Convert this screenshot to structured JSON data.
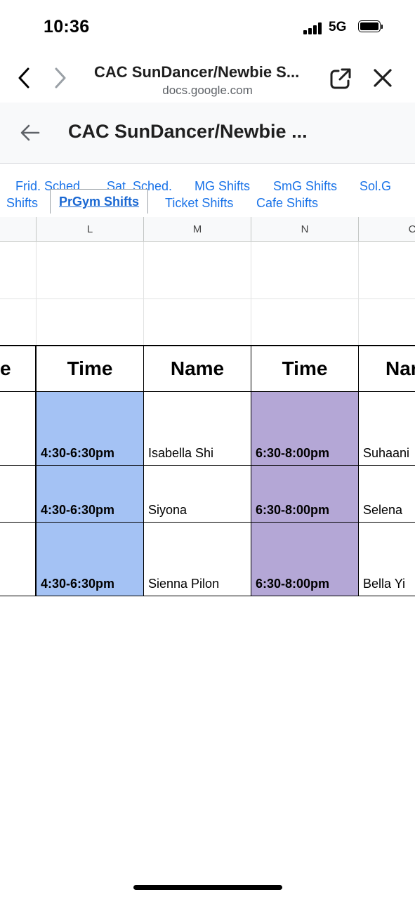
{
  "status_bar": {
    "time": "10:36",
    "network": "5G"
  },
  "browser": {
    "page_title": "CAC SunDancer/Newbie S...",
    "domain": "docs.google.com"
  },
  "app": {
    "doc_title": "CAC SunDancer/Newbie ..."
  },
  "tabs": {
    "items": [
      {
        "label": "Frid. Sched..."
      },
      {
        "label": "Sat. Sched."
      },
      {
        "label": "MG Shifts"
      },
      {
        "label": "SmG Shifts"
      },
      {
        "label": "Sol.G"
      },
      {
        "label": "Shifts"
      },
      {
        "label": "PrGym Shifts"
      },
      {
        "label": "Ticket Shifts"
      },
      {
        "label": "Cafe Shifts"
      }
    ],
    "active": "PrGym Shifts"
  },
  "grid": {
    "columns": [
      "L",
      "M",
      "N",
      "C"
    ],
    "headers": [
      "e",
      "Time",
      "Name",
      "Time",
      "Nar"
    ],
    "rows": [
      {
        "time1": "4:30-6:30pm",
        "name1": "Isabella Shi",
        "time2": "6:30-8:00pm",
        "name2": "Suhaani"
      },
      {
        "time1": "4:30-6:30pm",
        "name1": "Siyona",
        "time2": "6:30-8:00pm",
        "name2": "Selena"
      },
      {
        "time1": "4:30-6:30pm",
        "name1": "Sienna Pilon",
        "time2": "6:30-8:00pm",
        "name2": "Bella Yi"
      }
    ],
    "colors": {
      "time1_fill": "#a4c2f4",
      "time2_fill": "#b4a7d6"
    }
  }
}
